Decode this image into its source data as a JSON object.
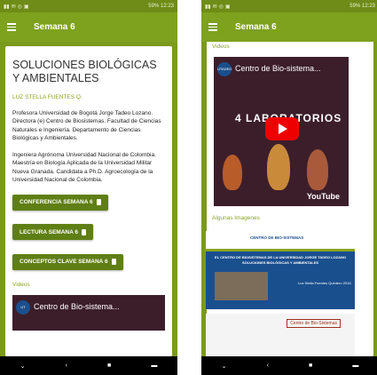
{
  "status_bar": {
    "time": "12:23",
    "battery": "59%",
    "icons": [
      "signal-icon",
      "wifi-icon",
      "notification-icons"
    ]
  },
  "app_bar": {
    "title": "Semana 6"
  },
  "left_panel": {
    "title": "SOLUCIONES BIOLÓGICAS Y AMBIENTALES",
    "author": "LUZ STELLA FUENTES Q.",
    "bio_1": "Profesora Universidad de Bogotá Jorge Tadeo Lozano. Directora (e) Centro de Biosistemas. Facultad de Ciencias Naturales e Ingeniería. Departamento de Ciencias Biológicas y Ambientales.",
    "bio_2": "Ingeniera Agrónoma Universidad Nacional de Colombia. Maestría en Biología Aplicada de la Universidad Militar Nueva Granada. Candidata a Ph.D. Agroecología de la Universidad Nacional de Colombia.",
    "buttons": [
      "CONFERENCIA SEMANA 6",
      "LECTURA SEMANA 6",
      "CONCEPTOS CLAVE SEMANA 6"
    ],
    "videos_label": "Videos",
    "video_title": "Centro de Bio-sistema..."
  },
  "right_panel": {
    "videos_label": "Videos",
    "video": {
      "logo": "UTADEO",
      "title": "Centro de Bio-sistema...",
      "overlay_text": "4 LABORATORIOS",
      "brand": "YouTube"
    },
    "images_label": "Algunas Imagenes",
    "image_1": {
      "caption": "EL CENTRO DE BIOSISTEMAS DE LA UNIVERSIDAD JORGE TADEO LOZANO SOLUCIONES BIOLÓGICAS Y AMBIENTALES",
      "presenter": "Luz Stella Fuentes Quintero 2016",
      "header_text": "CENTRO DE BIO-SISTEMAS"
    },
    "image_2": {
      "header_text": "Centro de Bio-Sistemas"
    }
  },
  "nav_bar": {
    "back": "‹",
    "home": "■",
    "recent": "▬",
    "down": "⌄"
  },
  "colors": {
    "primary": "#7ea11e",
    "dark_button": "#5f7f14",
    "accent_text": "#8aa51f"
  }
}
